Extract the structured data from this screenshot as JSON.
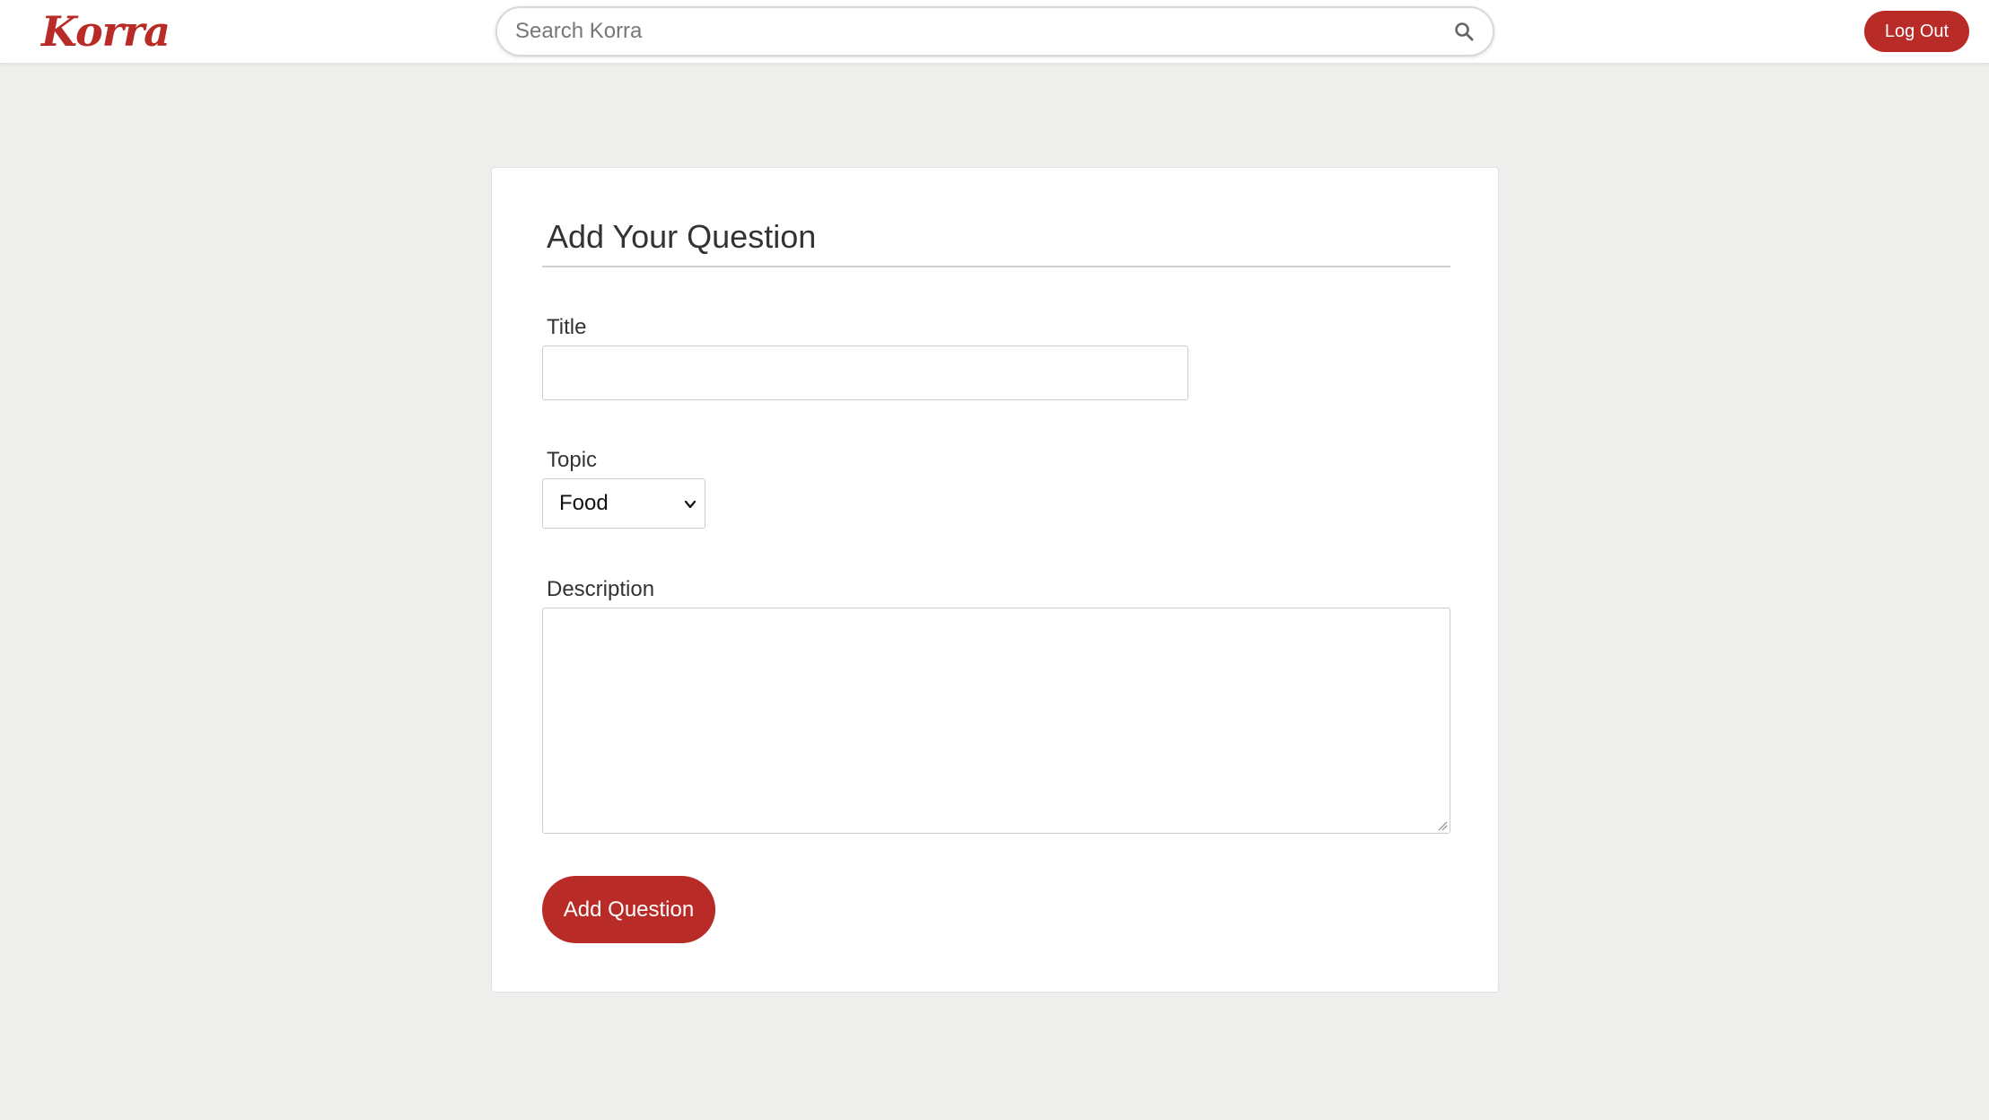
{
  "header": {
    "logo_text": "Korra",
    "search": {
      "placeholder": "Search Korra",
      "value": "",
      "icon": "search-icon"
    },
    "logout_label": "Log Out"
  },
  "form": {
    "heading": "Add Your Question",
    "title_label": "Title",
    "title_value": "",
    "topic_label": "Topic",
    "topic_selected": "Food",
    "description_label": "Description",
    "description_value": "",
    "submit_label": "Add Question"
  },
  "colors": {
    "brand": "#b92b27",
    "page_background": "#eeeeec",
    "card_background": "#ffffff"
  }
}
